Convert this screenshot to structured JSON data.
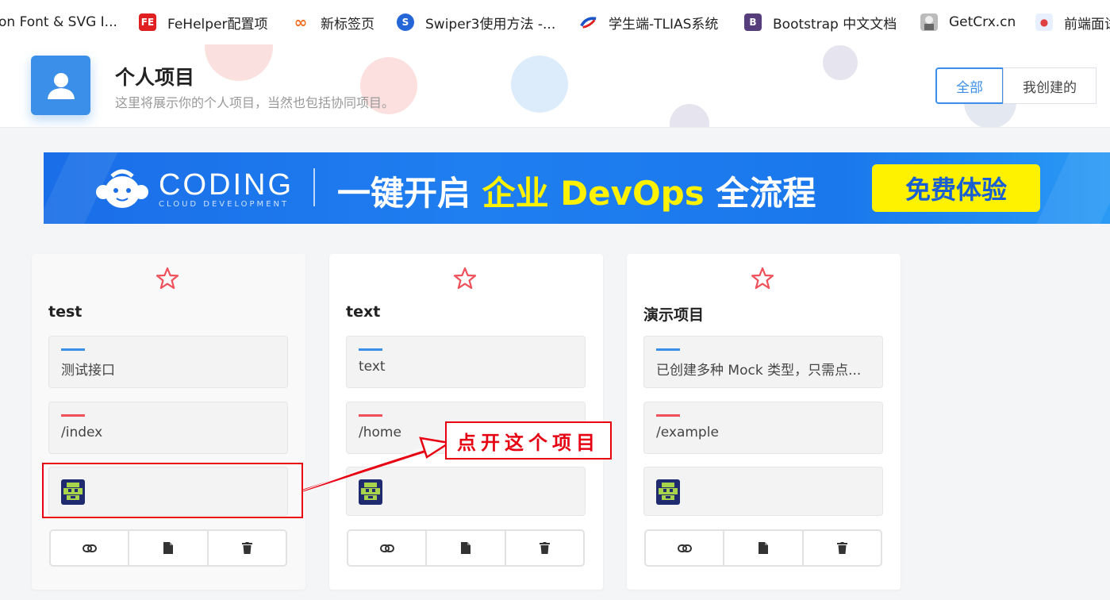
{
  "bookmarks": [
    {
      "label": "on Font & SVG I...",
      "icon": "font-icon",
      "color": "#ffffff"
    },
    {
      "label": "FeHelper配置项",
      "icon": "fehelper-icon",
      "color": "#e02020"
    },
    {
      "label": "新标签页",
      "icon": "infinity-icon",
      "color": "#f07020"
    },
    {
      "label": "Swiper3使用方法 -...",
      "icon": "swiper-icon",
      "color": "#2466d8"
    },
    {
      "label": "学生端-TLIAS系统",
      "icon": "tlias-icon",
      "color": "#1a56c8"
    },
    {
      "label": "Bootstrap 中文文档",
      "icon": "bootstrap-icon",
      "color": "#563d7c"
    },
    {
      "label": "GetCrx.cn",
      "icon": "getcrx-icon",
      "color": "#888888"
    },
    {
      "label": "前端面试",
      "icon": "frontend-icon",
      "color": "#e04040"
    }
  ],
  "header": {
    "title": "个人项目",
    "subtitle": "这里将展示你的个人项目，当然也包括协同项目。",
    "filters": [
      "全部",
      "我创建的"
    ],
    "active_filter": "全部"
  },
  "banner": {
    "brand": "CODING",
    "brand_sub": "CLOUD DEVELOPMENT",
    "slogan_part1": "一键开启 ",
    "slogan_highlight": "企业 DevOps",
    "slogan_part2": " 全流程",
    "cta": "免费体验"
  },
  "projects": [
    {
      "name": "test",
      "description": "测试接口",
      "url": "/index"
    },
    {
      "name": "text",
      "description": "text",
      "url": "/home"
    },
    {
      "name": "演示项目",
      "description": "已创建多种 Mock 类型，只需点...",
      "url": "/example"
    }
  ],
  "annotation": {
    "text": "点开这个项目"
  },
  "colors": {
    "accent": "#3b8fe8",
    "desc_bar": "#3b8fe8",
    "url_bar": "#f0505a",
    "star": "#f0505a",
    "annotation": "#e60012"
  }
}
